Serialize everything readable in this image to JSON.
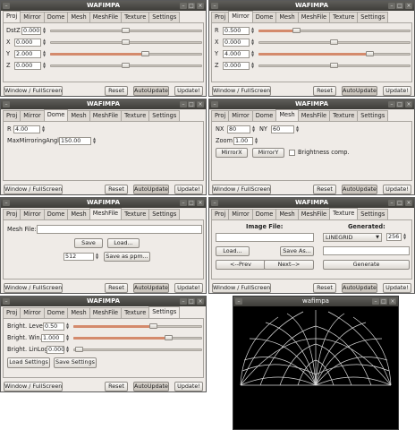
{
  "titles": {
    "main": "WAFIMPA",
    "view": "wafimpa"
  },
  "tabs": [
    "Proj",
    "Mirror",
    "Dome",
    "Mesh",
    "MeshFile",
    "Texture",
    "Settings"
  ],
  "bottom": {
    "window": "Window / FullScreen",
    "reset": "Reset",
    "autoupdate": "AutoUpdate",
    "update": "Update!"
  },
  "proj": {
    "rows": [
      {
        "label": "DstZ",
        "value": "0.000",
        "level": 0.5
      },
      {
        "label": "X",
        "value": "0.000",
        "level": 0.5
      },
      {
        "label": "Y",
        "value": "2.000",
        "level": 0.6
      },
      {
        "label": "Z",
        "value": "0.000",
        "level": 0.5
      }
    ]
  },
  "mirror": {
    "rows": [
      {
        "label": "R",
        "value": "0.500",
        "level": 0.35
      },
      {
        "label": "X",
        "value": "0.000",
        "level": 0.5
      },
      {
        "label": "Y",
        "value": "4.000",
        "level": 0.7
      },
      {
        "label": "Z",
        "value": "0.000",
        "level": 0.5
      }
    ]
  },
  "dome": {
    "r_label": "R",
    "r_value": "4.00",
    "angle_label": "MaxMirroringAngle",
    "angle_value": "150.00"
  },
  "mesh": {
    "nx_label": "NX",
    "nx_value": "80",
    "ny_label": "NY",
    "ny_value": "60",
    "zoom_label": "Zoom",
    "zoom_value": "1.00",
    "mirrorx": "MirrorX",
    "mirrory": "MirrorY",
    "brightness": "Brightness comp."
  },
  "meshfile": {
    "file_label": "Mesh File:",
    "save": "Save",
    "load": "Load...",
    "size": "512",
    "save_ppm": "Save as ppm..."
  },
  "texture": {
    "image_label": "Image File:",
    "generated_label": "Generated:",
    "linegrid": "LINEGRID",
    "gen_size": "256",
    "load": "Load...",
    "saveas": "Save As...",
    "prev": "<--Prev",
    "next": "Next-->",
    "generate": "Generate"
  },
  "settings": {
    "rows": [
      {
        "label": "Bright. Level",
        "value": "0.50",
        "level": 0.5
      },
      {
        "label": "Bright. Win.",
        "value": "1.000",
        "level": 0.6
      },
      {
        "label": "Bright. LinLog",
        "value": "0.000",
        "level": 0.0
      }
    ],
    "load": "Load Settings",
    "save": "Save Settings"
  }
}
